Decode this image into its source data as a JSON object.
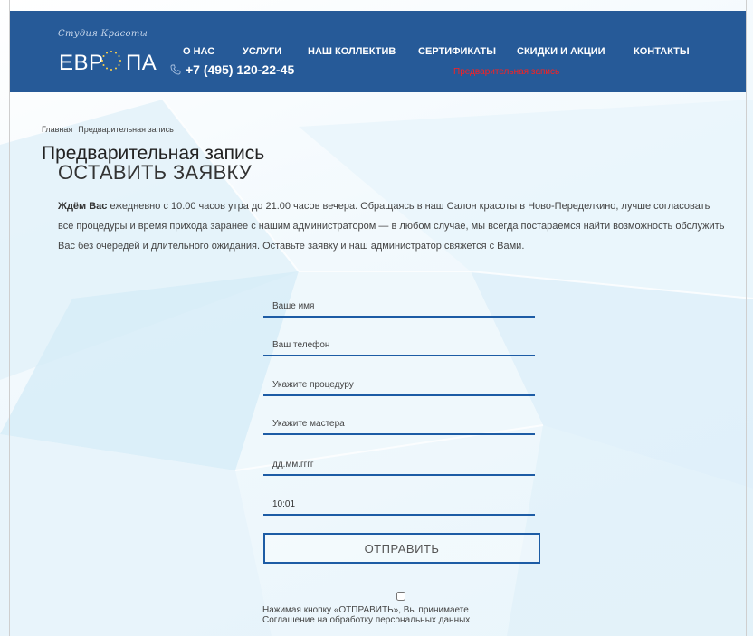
{
  "header": {
    "logo_script": "Студия Красоты",
    "logo_main": "ЕВР ПА",
    "nav": [
      {
        "label": "О НАС"
      },
      {
        "label": "УСЛУГИ"
      },
      {
        "label": "НАШ КОЛЛЕКТИВ"
      },
      {
        "label": "СЕРТИФИКАТЫ"
      },
      {
        "label": "СКИДКИ И АКЦИИ"
      },
      {
        "label": "КОНТАКТЫ"
      }
    ],
    "phone": "+7 (495) 120-22-45",
    "booking_link": "Предварительная запись",
    "colors": {
      "header_bg": "#265a98",
      "booking_link": "#ff1f1f"
    }
  },
  "breadcrumb": [
    "Главная",
    "Предварительная запись"
  ],
  "page_title": "Предварительная запись",
  "section_title": "ОСТАВИТЬ ЗАЯВКУ",
  "intro": {
    "bold": "Ждём Вас",
    "text": " ежедневно с 10.00 часов утра до 21.00 часов вечера. Обращаясь в наш Салон красоты в Ново-Переделкино, лучше согласовать все процедуры и время прихода заранее с нашим администратором — в любом случае, мы всегда постараемся найти возможность обслужить Вас без очередей и длительного ожидания. Оставьте заявку и наш администратор свяжется с Вами."
  },
  "form": {
    "name_placeholder": "Ваше имя",
    "phone_placeholder": "Ваш телефон",
    "procedure_placeholder": "Укажите процедуру",
    "master_placeholder": "Укажите мастера",
    "date_placeholder": "дд.мм.гггг",
    "time_value": "10:01",
    "submit_label": "ОТПРАВИТЬ",
    "agree_line1": "Нажимая кнопку «ОТПРАВИТЬ», Вы принимаете",
    "agree_line2": "Соглашение на обработку персональных данных",
    "accent_color": "#1d5ca5"
  }
}
